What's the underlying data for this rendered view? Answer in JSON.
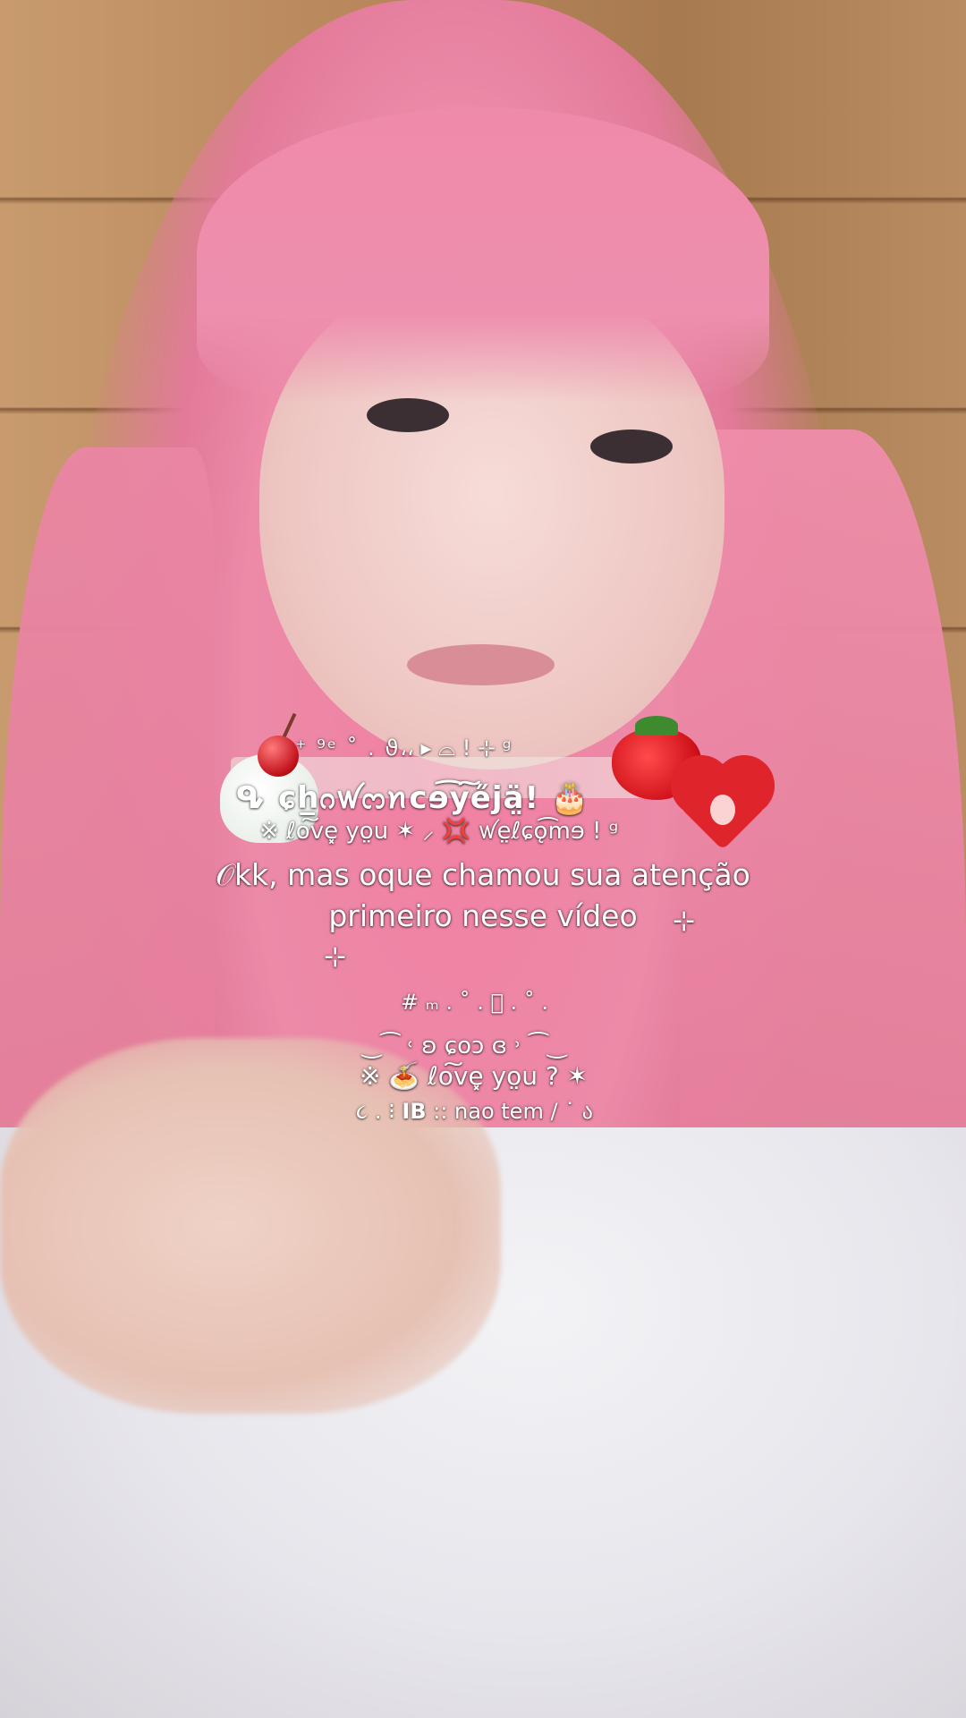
{
  "overlay": {
    "deco_top": "⁺ ⁹ᵉ ˚ . ϑ،، ▸ ⌓ ! ⊹ ᵍ",
    "title": "ᕴ ɕh̲ᦅꪝᦂꪀcɘ͡y͠e̋jä̤! 🎂",
    "deco_mid": "※ ℓo͠ve͓ yo̤u ✶ ⸝ 💢 ꪝe̤ℓɕǫ͡mɘ ! ᵍ",
    "caption": "𝒪kk, mas oque chamou sua atenção primeiro nesse vídeo",
    "sparkle_right": "⊹",
    "sparkle_left": "⊹",
    "deco_line1": "# ₘ . ˚ . 𝆅 . ˚ .",
    "deco_line2": "‿⁀ ˓ ʚ ɕoɔ ɞ ˒ ⁀‿",
    "deco_line3": "※ 🍝 ℓo͠ve͓ yo̤u ? ✶",
    "deco_line4_pre": "૮ . ⁝",
    "deco_line4_bold": "IB",
    "deco_line4_post": ":: nao tem / ˙ ა"
  },
  "stickers": {
    "cupcake": "cupcake",
    "strawberry": "strawberry",
    "heart_strawberry": "heart-shaped strawberry"
  }
}
